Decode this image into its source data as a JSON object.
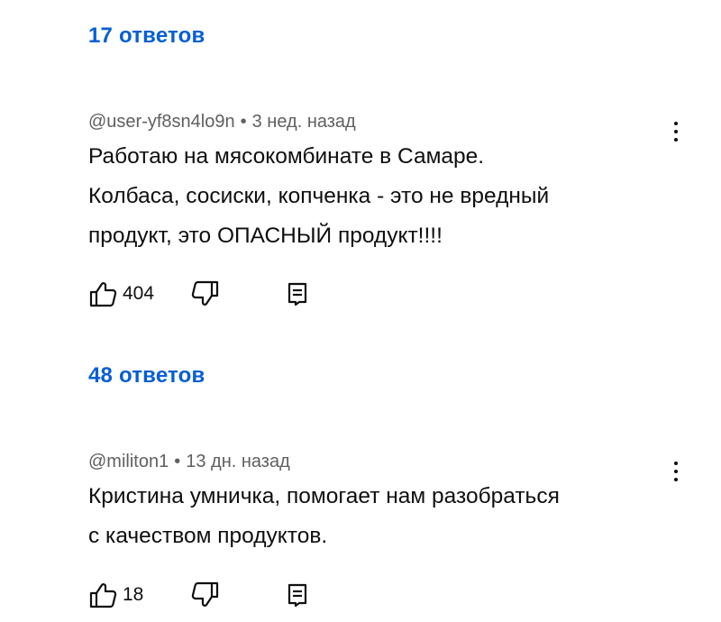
{
  "thread1": {
    "replies_label": "17 ответов"
  },
  "comment1": {
    "author": "@user-yf8sn4lo9n",
    "separator": "•",
    "time": "3 нед. назад",
    "lines": [
      "Работаю на мясокомбинате в Самаре.",
      "Колбаса, сосиски, копченка - это не вредный",
      "продукт, это ОПАСНЫЙ продукт!!!!"
    ],
    "likes": "404",
    "replies_label": "48 ответов"
  },
  "comment2": {
    "author": "@militon1",
    "separator": "•",
    "time": "13 дн. назад",
    "lines": [
      "Кристина умничка, помогает нам разобраться",
      "с качеством продуктов."
    ],
    "likes": "18"
  },
  "icons": {
    "like": "thumb-up-outline",
    "dislike": "thumb-down-outline",
    "reply": "comment-reply",
    "more": "vertical-dots"
  },
  "colors": {
    "link": "#065fd4",
    "meta": "#606060",
    "text": "#0f0f0f"
  }
}
